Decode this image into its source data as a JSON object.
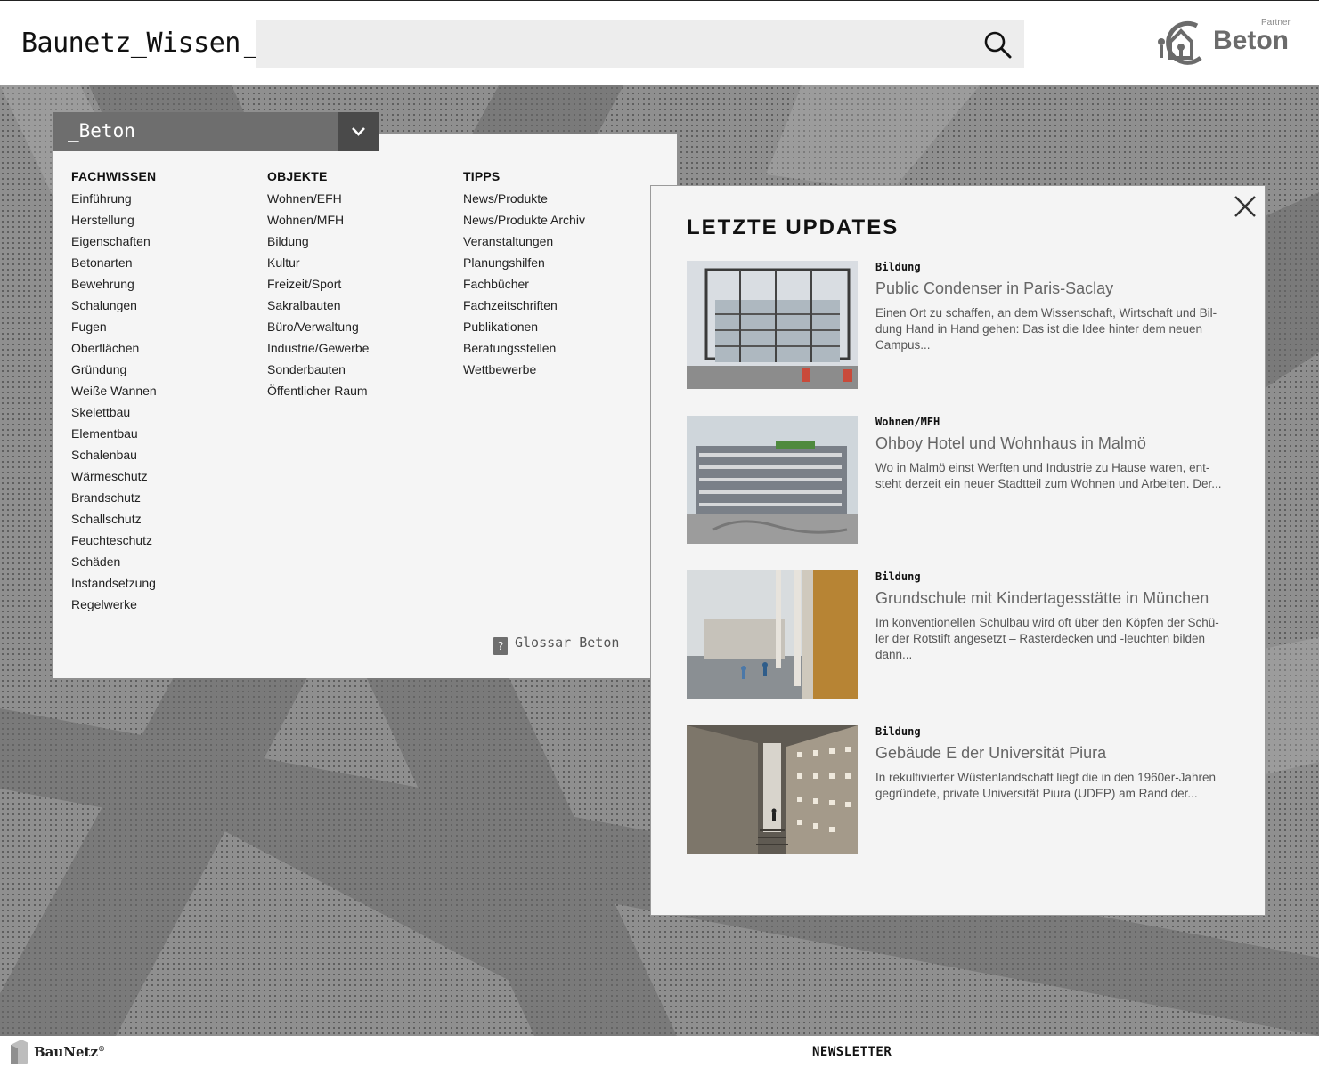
{
  "header": {
    "site_title": "Baunetz_Wissen",
    "cursor": "_",
    "search": {
      "placeholder": "",
      "value": ""
    },
    "partner_label": "Partner",
    "partner_name": "Beton"
  },
  "menu": {
    "category": "_Beton",
    "columns": [
      {
        "heading": "FACHWISSEN",
        "items": [
          "Einführung",
          "Herstellung",
          "Eigenschaften",
          "Betonarten",
          "Bewehrung",
          "Schalungen",
          "Fugen",
          "Oberflächen",
          "Gründung",
          "Weiße Wannen",
          "Skelettbau",
          "Elementbau",
          "Schalenbau",
          "Wärmeschutz",
          "Brandschutz",
          "Schallschutz",
          "Feuchteschutz",
          "Schäden",
          "Instandsetzung",
          "Regelwerke"
        ]
      },
      {
        "heading": "OBJEKTE",
        "items": [
          "Wohnen/EFH",
          "Wohnen/MFH",
          "Bildung",
          "Kultur",
          "Freizeit/Sport",
          "Sakralbauten",
          "Büro/Verwaltung",
          "Industrie/Gewerbe",
          "Sonderbauten",
          "Öffentlicher Raum"
        ]
      },
      {
        "heading": "TIPPS",
        "items": [
          "News/Produkte",
          "News/Produkte Archiv",
          "Veranstaltungen",
          "Planungshilfen",
          "Fachbücher",
          "Fachzeitschriften",
          "Publikationen",
          "Beratungsstellen",
          "Wettbewerbe"
        ]
      }
    ],
    "glossar_label": "Glossar Beton",
    "glossar_icon": "?"
  },
  "updates": {
    "title": "LETZTE UPDATES",
    "items": [
      {
        "category": "Bildung",
        "title": "Public Condenser in Paris-Saclay",
        "description": "Einen Ort zu schaffen, an dem Wissenschaft, Wirtschaft und Bil-dung Hand in Hand gehen: Das ist die Idee hinter dem neuen Campus..."
      },
      {
        "category": "Wohnen/MFH",
        "title": "Ohboy Hotel und Wohnhaus in Malmö",
        "description": "Wo in Malmö einst Werften und Industrie zu Hause waren, ent-steht derzeit ein neuer Stadtteil zum Wohnen und Arbeiten. Der..."
      },
      {
        "category": "Bildung",
        "title": "Grundschule mit Kindertagesstätte in München",
        "description": "Im konventionellen Schulbau wird oft über den Köpfen der Schü-ler der Rotstift angesetzt – Rasterdecken und -leuchten bilden dann..."
      },
      {
        "category": "Bildung",
        "title": "Gebäude E der Universität Piura",
        "description": "In rekultivierter Wüstenlandschaft liegt die in den 1960er-Jahren gegründete, private Universität Piura (UDEP) am Rand der..."
      }
    ]
  },
  "footer": {
    "brand": "BauNetz",
    "brand_mark": "®",
    "newsletter": "NEWSLETTER"
  },
  "colors": {
    "menu_bar": "#6e6e6e",
    "menu_toggle": "#4a4a4a",
    "panel_bg": "#f5f5f5",
    "partner_logo": "#6b6b6b"
  }
}
